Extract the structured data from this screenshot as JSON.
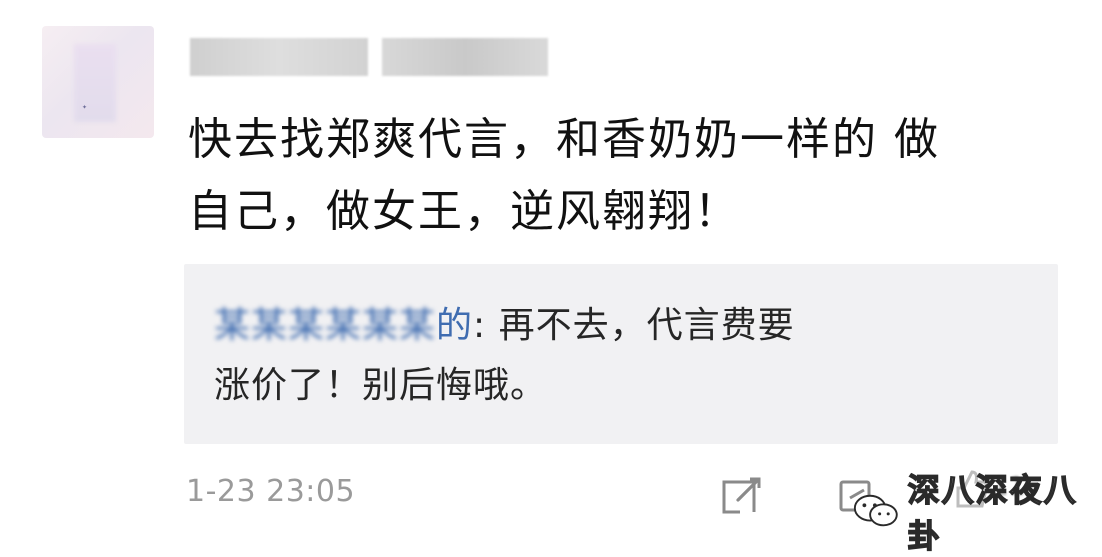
{
  "comment": {
    "username": "",
    "text_line1": "快去找郑爽代言，和香奶奶一样的 做",
    "text_line2": "自己，做女王，逆风翱翔！",
    "reply": {
      "user_tail": "的",
      "separator": ": ",
      "text_line1": "再不去，代言费要",
      "text_line2": "涨价了！别后悔哦。"
    },
    "timestamp": "1-23 23:05"
  },
  "actions": {
    "reply_icon": "edit-reply-icon",
    "share_icon": "share-icon",
    "like_icon": "thumbs-up-icon"
  },
  "watermark": {
    "text": "深八深夜八卦",
    "logo": "wechat-logo"
  },
  "colors": {
    "text": "#111111",
    "reply_background": "#f1f1f3",
    "reply_username": "#3f6cb0",
    "timestamp": "#9a9a9a"
  }
}
